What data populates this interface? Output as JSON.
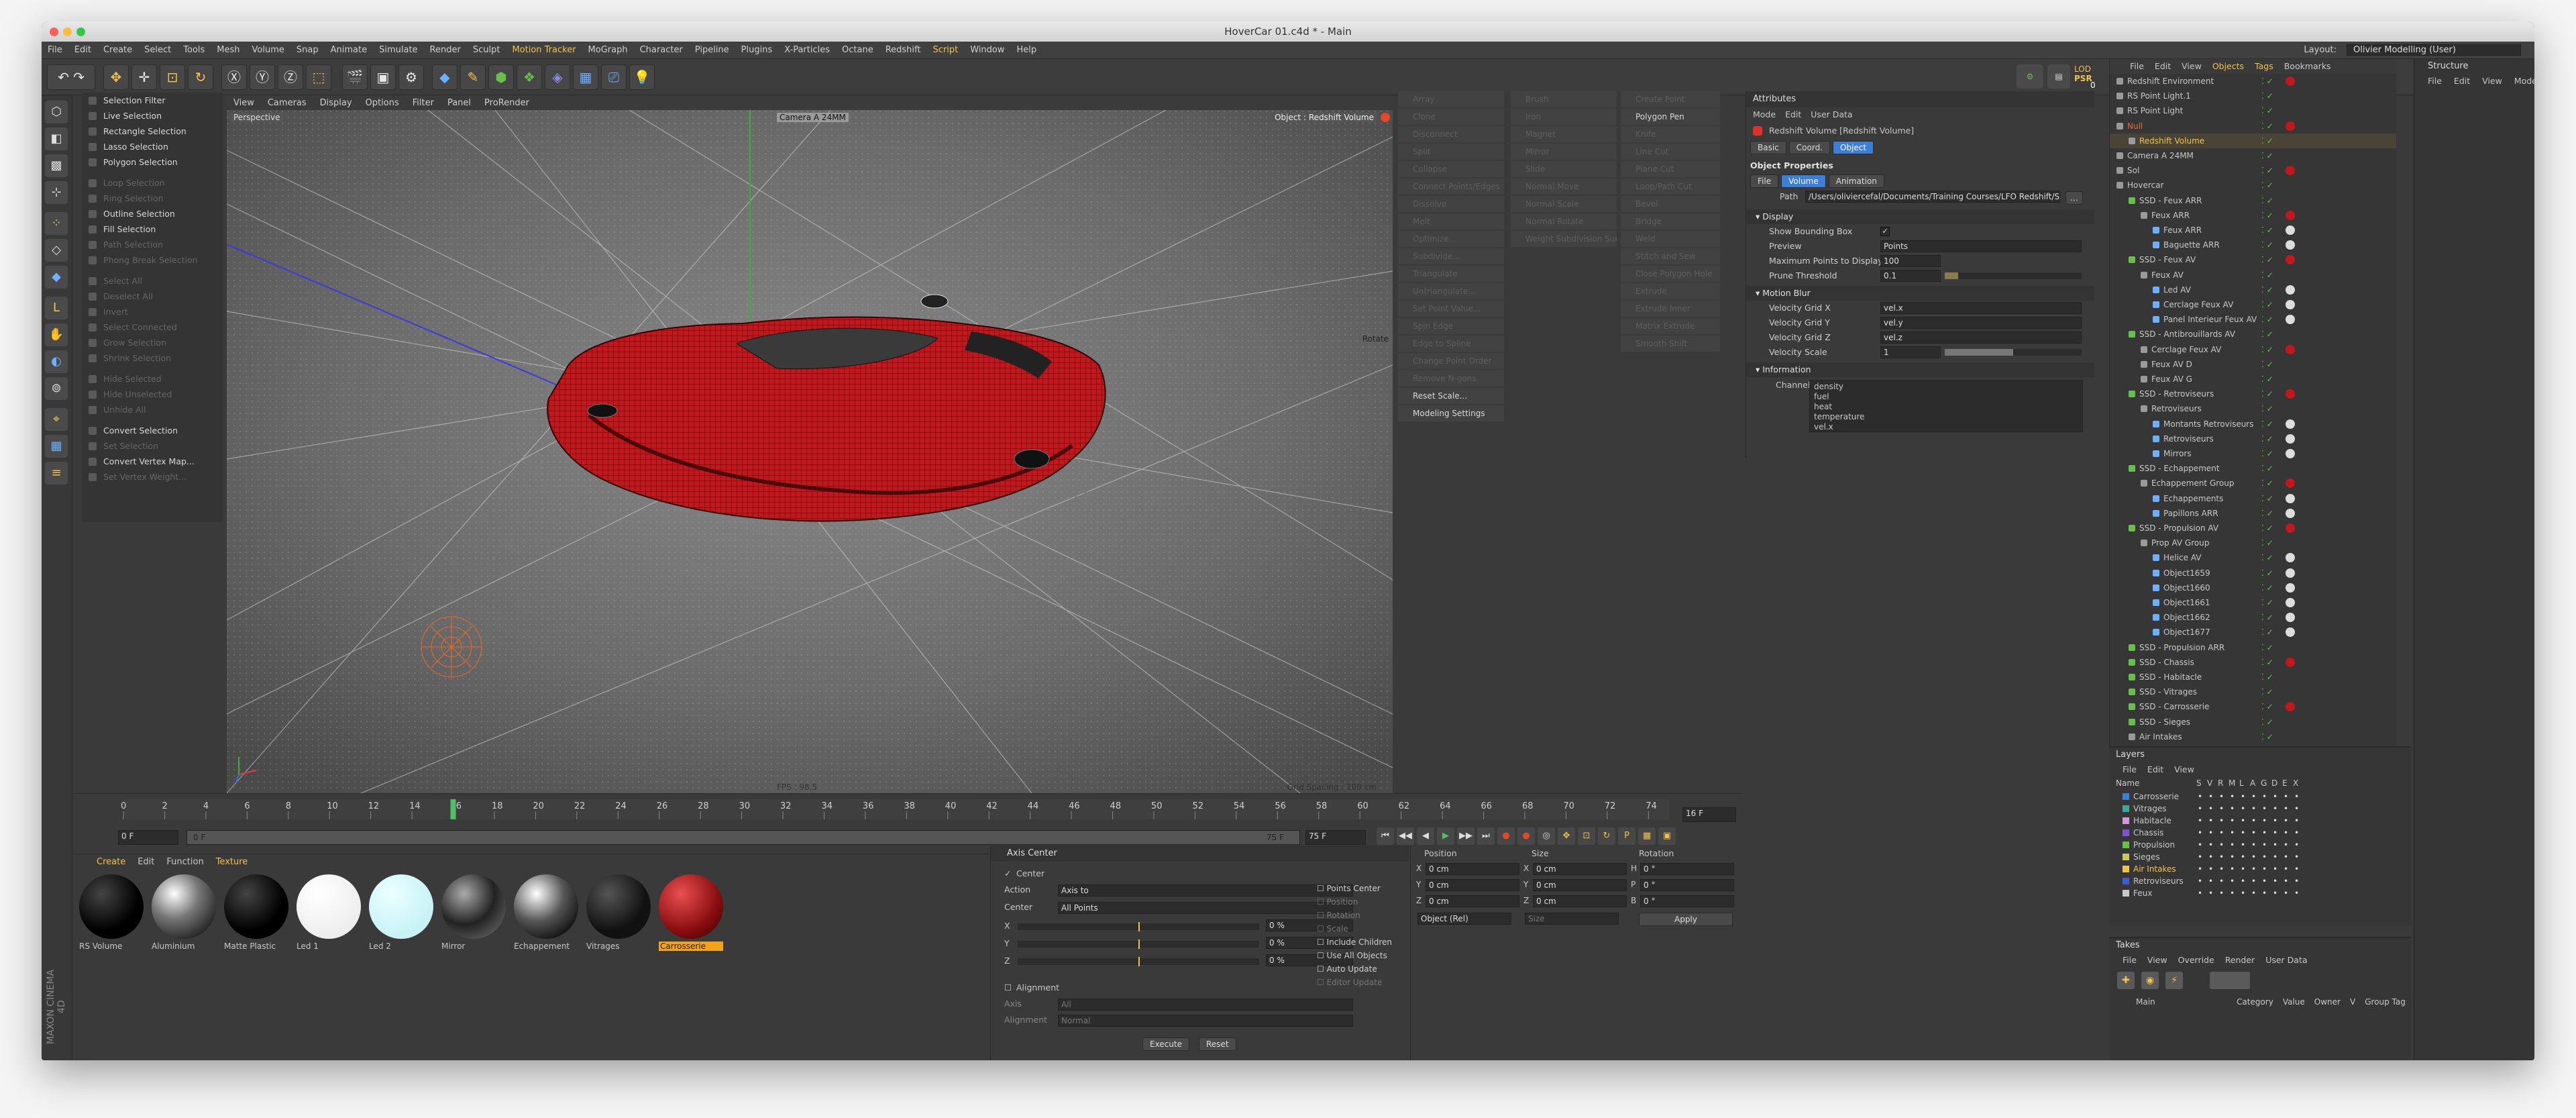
{
  "window": {
    "title": "HoverCar 01.c4d * - Main"
  },
  "menu": [
    "File",
    "Edit",
    "Create",
    "Select",
    "Tools",
    "Mesh",
    "Volume",
    "Snap",
    "Animate",
    "Simulate",
    "Render",
    "Sculpt",
    "Motion Tracker",
    "MoGraph",
    "Character",
    "Pipeline",
    "Plugins",
    "X-Particles",
    "Octane",
    "Redshift",
    "Script",
    "Window",
    "Help"
  ],
  "menu_highlight": [
    "Motion Tracker",
    "Script"
  ],
  "layout": {
    "label": "Layout:",
    "value": "Olivier Modelling (User)"
  },
  "toolbar": {
    "lod_label": "LOD",
    "psr_label": "PSR",
    "psr_value": "0"
  },
  "commands": [
    {
      "label": "Selection Filter",
      "on": true
    },
    {
      "label": "Live Selection",
      "on": true
    },
    {
      "label": "Rectangle Selection",
      "on": true
    },
    {
      "label": "Lasso Selection",
      "on": true
    },
    {
      "label": "Polygon Selection",
      "on": true
    },
    {
      "label": "Loop Selection",
      "on": false
    },
    {
      "label": "Ring Selection",
      "on": false
    },
    {
      "label": "Outline Selection",
      "on": true
    },
    {
      "label": "Fill Selection",
      "on": true
    },
    {
      "label": "Path Selection",
      "on": false
    },
    {
      "label": "Phong Break Selection",
      "on": false
    },
    {
      "label": "Select All",
      "on": false
    },
    {
      "label": "Deselect All",
      "on": false
    },
    {
      "label": "Invert",
      "on": false
    },
    {
      "label": "Select Connected",
      "on": false
    },
    {
      "label": "Grow Selection",
      "on": false
    },
    {
      "label": "Shrink Selection",
      "on": false
    },
    {
      "label": "Hide Selected",
      "on": false
    },
    {
      "label": "Hide Unselected",
      "on": false
    },
    {
      "label": "Unhide All",
      "on": false
    },
    {
      "label": "Convert Selection",
      "on": true
    },
    {
      "label": "Set Selection",
      "on": false
    },
    {
      "label": "Convert Vertex Map...",
      "on": true
    },
    {
      "label": "Set Vertex Weight...",
      "on": false
    }
  ],
  "viewport": {
    "menu": [
      "View",
      "Cameras",
      "Display",
      "Options",
      "Filter",
      "Panel",
      "ProRender"
    ],
    "mode": "Perspective",
    "camera": "Camera A 24MM",
    "object_label": "Object : Redshift Volume",
    "fps": "FPS : 98.5",
    "grid_spacing": "Grid Spacing : 100 cm",
    "rotate_label": "Rotate"
  },
  "right_commands": {
    "col1": [
      {
        "label": "Array",
        "on": false
      },
      {
        "label": "Clone",
        "on": false
      },
      {
        "label": "Disconnect",
        "on": false
      },
      {
        "label": "Split",
        "on": false
      },
      {
        "label": "Collapse",
        "on": false
      },
      {
        "label": "Connect Points/Edges",
        "on": false
      },
      {
        "label": "Dissolve",
        "on": false
      },
      {
        "label": "Melt",
        "on": false
      },
      {
        "label": "Optimize...",
        "on": false
      },
      {
        "label": "Subdivide...",
        "on": false
      },
      {
        "label": "Triangulate",
        "on": false
      },
      {
        "label": "Untriangulate...",
        "on": false
      },
      {
        "label": "Set Point Value...",
        "on": false
      },
      {
        "label": "Spin Edge",
        "on": false
      },
      {
        "label": "Edge to Spline",
        "on": false
      },
      {
        "label": "Change Point Order",
        "on": false
      },
      {
        "label": "Remove N-gons",
        "on": false
      },
      {
        "label": "Reset Scale...",
        "on": true
      },
      {
        "label": "Modeling Settings",
        "on": true
      }
    ],
    "col2": [
      {
        "label": "Brush",
        "on": false
      },
      {
        "label": "Iron",
        "on": false
      },
      {
        "label": "Magnet",
        "on": false
      },
      {
        "label": "Mirror",
        "on": false
      },
      {
        "label": "Slide",
        "on": false
      },
      {
        "label": "Normal Move",
        "on": false
      },
      {
        "label": "Normal Scale",
        "on": false
      },
      {
        "label": "Normal Rotate",
        "on": false
      },
      {
        "label": "Weight Subdivision Surface",
        "on": false
      }
    ],
    "col3": [
      {
        "label": "Create Point",
        "on": false
      },
      {
        "label": "Polygon Pen",
        "on": true
      },
      {
        "label": "Knife",
        "on": false
      },
      {
        "label": "Line Cut",
        "on": false
      },
      {
        "label": "Plane Cut",
        "on": false
      },
      {
        "label": "Loop/Path Cut",
        "on": false
      },
      {
        "label": "Bevel",
        "on": false
      },
      {
        "label": "Bridge",
        "on": false
      },
      {
        "label": "Weld",
        "on": false
      },
      {
        "label": "Stitch and Sew",
        "on": false
      },
      {
        "label": "Close Polygon Hole",
        "on": false
      },
      {
        "label": "Extrude",
        "on": false
      },
      {
        "label": "Extrude Inner",
        "on": false
      },
      {
        "label": "Matrix Extrude",
        "on": false
      },
      {
        "label": "Smooth Shift",
        "on": false
      }
    ]
  },
  "attributes": {
    "header": "Attributes",
    "menu": [
      "Mode",
      "Edit",
      "User Data"
    ],
    "object_title": "Redshift Volume [Redshift Volume]",
    "tabs": [
      "Basic",
      "Coord.",
      "Object"
    ],
    "section": "Object Properties",
    "subtabs": [
      "File",
      "Volume",
      "Animation"
    ],
    "path_label": "Path",
    "path_value": "/Users/oliviercefal/Documents/Training Courses/LFO Redshift/Sce",
    "display_section": "Display",
    "show_bbox": "Show Bounding Box",
    "preview_label": "Preview",
    "preview_value": "Points",
    "max_points_label": "Maximum Points to Display",
    "max_points_value": "100",
    "prune_label": "Prune Threshold",
    "prune_value": "0.1",
    "motion_section": "Motion Blur",
    "vgx_label": "Velocity Grid X",
    "vgx_value": "vel.x",
    "vgy_label": "Velocity Grid Y",
    "vgy_value": "vel.y",
    "vgz_label": "Velocity Grid Z",
    "vgz_value": "vel.z",
    "vscale_label": "Velocity Scale",
    "vscale_value": "1",
    "info_section": "Information",
    "channels_label": "Channels",
    "channels": [
      "density",
      "fuel",
      "heat",
      "temperature",
      "vel.x"
    ]
  },
  "object_manager": {
    "menu": [
      "File",
      "Edit",
      "View",
      "Objects",
      "Tags",
      "Bookmarks"
    ],
    "rows": [
      {
        "name": "Redshift Environment",
        "indent": 0,
        "color": "#c8c8c8"
      },
      {
        "name": "RS Point Light.1",
        "indent": 0,
        "color": "#c8c8c8"
      },
      {
        "name": "RS Point Light",
        "indent": 0,
        "color": "#c8c8c8"
      },
      {
        "name": "Null",
        "indent": 0,
        "color": "#e06a3a"
      },
      {
        "name": "Redshift Volume",
        "indent": 1,
        "color": "#f3c24d"
      },
      {
        "name": "Camera A 24MM",
        "indent": 0,
        "color": "#c8c8c8"
      },
      {
        "name": "Sol",
        "indent": 0,
        "color": "#c8c8c8"
      },
      {
        "name": "Hovercar",
        "indent": 0,
        "color": "#c8c8c8"
      },
      {
        "name": "SSD - Feux ARR",
        "indent": 1,
        "color": "#c8c8c8"
      },
      {
        "name": "Feux ARR",
        "indent": 2,
        "color": "#c8c8c8"
      },
      {
        "name": "Feux ARR",
        "indent": 3,
        "color": "#c8c8c8"
      },
      {
        "name": "Baguette ARR",
        "indent": 3,
        "color": "#c8c8c8"
      },
      {
        "name": "SSD - Feux AV",
        "indent": 1,
        "color": "#c8c8c8"
      },
      {
        "name": "Feux AV",
        "indent": 2,
        "color": "#c8c8c8"
      },
      {
        "name": "Led AV",
        "indent": 3,
        "color": "#c8c8c8"
      },
      {
        "name": "Cerclage Feux AV",
        "indent": 3,
        "color": "#c8c8c8"
      },
      {
        "name": "Panel Interieur Feux AV",
        "indent": 3,
        "color": "#c8c8c8"
      },
      {
        "name": "SSD - Antibrouillards AV",
        "indent": 1,
        "color": "#c8c8c8"
      },
      {
        "name": "Cerclage Feux AV",
        "indent": 2,
        "color": "#c8c8c8"
      },
      {
        "name": "Feux AV D",
        "indent": 2,
        "color": "#c8c8c8"
      },
      {
        "name": "Feux AV G",
        "indent": 2,
        "color": "#c8c8c8"
      },
      {
        "name": "SSD - Retroviseurs",
        "indent": 1,
        "color": "#c8c8c8"
      },
      {
        "name": "Retroviseurs",
        "indent": 2,
        "color": "#c8c8c8"
      },
      {
        "name": "Montants Retroviseurs",
        "indent": 3,
        "color": "#c8c8c8"
      },
      {
        "name": "Retroviseurs",
        "indent": 3,
        "color": "#c8c8c8"
      },
      {
        "name": "Mirrors",
        "indent": 3,
        "color": "#c8c8c8"
      },
      {
        "name": "SSD - Echappement",
        "indent": 1,
        "color": "#c8c8c8"
      },
      {
        "name": "Echappement Group",
        "indent": 2,
        "color": "#c8c8c8"
      },
      {
        "name": "Echappements",
        "indent": 3,
        "color": "#c8c8c8"
      },
      {
        "name": "Papillons ARR",
        "indent": 3,
        "color": "#c8c8c8"
      },
      {
        "name": "SSD - Propulsion AV",
        "indent": 1,
        "color": "#c8c8c8"
      },
      {
        "name": "Prop AV Group",
        "indent": 2,
        "color": "#c8c8c8"
      },
      {
        "name": "Helice AV",
        "indent": 3,
        "color": "#c8c8c8"
      },
      {
        "name": "Object1659",
        "indent": 3,
        "color": "#c8c8c8"
      },
      {
        "name": "Object1660",
        "indent": 3,
        "color": "#c8c8c8"
      },
      {
        "name": "Object1661",
        "indent": 3,
        "color": "#c8c8c8"
      },
      {
        "name": "Object1662",
        "indent": 3,
        "color": "#c8c8c8"
      },
      {
        "name": "Object1677",
        "indent": 3,
        "color": "#c8c8c8"
      },
      {
        "name": "SSD - Propulsion ARR",
        "indent": 1,
        "color": "#c8c8c8"
      },
      {
        "name": "SSD - Chassis",
        "indent": 1,
        "color": "#c8c8c8"
      },
      {
        "name": "SSD - Habitacle",
        "indent": 1,
        "color": "#c8c8c8"
      },
      {
        "name": "SSD - Vitrages",
        "indent": 1,
        "color": "#c8c8c8"
      },
      {
        "name": "SSD - Carrosserie",
        "indent": 1,
        "color": "#c8c8c8"
      },
      {
        "name": "SSD - Sieges",
        "indent": 1,
        "color": "#c8c8c8"
      },
      {
        "name": "Air Intakes",
        "indent": 1,
        "color": "#c8c8c8"
      }
    ]
  },
  "structure": {
    "header": "Structure",
    "menu": [
      "File",
      "Edit",
      "View",
      "Mode"
    ]
  },
  "layers": {
    "header": "Layers",
    "menu": [
      "File",
      "Edit",
      "View"
    ],
    "col_name": "Name",
    "cols": [
      "S",
      "V",
      "R",
      "M",
      "L",
      "A",
      "G",
      "D",
      "E",
      "X"
    ],
    "items": [
      {
        "name": "Carrosserie",
        "color": "#3d7fd6"
      },
      {
        "name": "Vitrages",
        "color": "#3aa89a"
      },
      {
        "name": "Habitacle",
        "color": "#d29ad6"
      },
      {
        "name": "Chassis",
        "color": "#7a55d0"
      },
      {
        "name": "Propulsion",
        "color": "#66c04a"
      },
      {
        "name": "Sieges",
        "color": "#c8c860"
      },
      {
        "name": "Air Intakes",
        "color": "#f3c24d"
      },
      {
        "name": "Retroviseurs",
        "color": "#3a5dd0"
      },
      {
        "name": "Feux",
        "color": "#c8c8c8"
      }
    ]
  },
  "takes": {
    "header": "Takes",
    "menu": [
      "File",
      "View",
      "Override",
      "Render",
      "User Data"
    ],
    "main_label": "Main",
    "cols": [
      "Category",
      "Value",
      "Owner",
      "V",
      "Group Tag"
    ]
  },
  "timeline": {
    "ticks": [
      "0",
      "2",
      "4",
      "6",
      "8",
      "10",
      "12",
      "14",
      "16",
      "18",
      "20",
      "22",
      "24",
      "26",
      "28",
      "30",
      "32",
      "34",
      "36",
      "38",
      "40",
      "42",
      "44",
      "46",
      "48",
      "50",
      "52",
      "54",
      "56",
      "58",
      "60",
      "62",
      "64",
      "66",
      "68",
      "70",
      "72",
      "74"
    ],
    "current_frame": "16 F",
    "playhead_frame": 16,
    "max_frame": 75,
    "start_field": "0 F",
    "range_start": "0 F",
    "range_end": "75 F",
    "end_field": "75 F",
    "range_label": "75 F"
  },
  "materials": {
    "menu": [
      "Create",
      "Edit",
      "Function",
      "Texture"
    ],
    "items": [
      {
        "name": "RS Volume",
        "kind": "dark"
      },
      {
        "name": "Aluminium",
        "kind": "metal"
      },
      {
        "name": "Matte Plastic",
        "kind": "dark"
      },
      {
        "name": "Led 1",
        "kind": "white"
      },
      {
        "name": "Led 2",
        "kind": "cyan"
      },
      {
        "name": "Mirror",
        "kind": "mirror"
      },
      {
        "name": "Echappement",
        "kind": "chrome"
      },
      {
        "name": "Vitrages",
        "kind": "glass"
      },
      {
        "name": "Carrosserie",
        "kind": "red"
      }
    ],
    "selected": "Carrosserie",
    "vendor": "MAXON CINEMA 4D"
  },
  "axis_center": {
    "title": "Axis Center",
    "center_label": "Center",
    "action_label": "Action",
    "action_value": "Axis to",
    "center_mode_label": "Center",
    "center_mode_value": "All Points",
    "x_label": "X",
    "x_value": "0 %",
    "y_label": "Y",
    "y_value": "0 %",
    "z_label": "Z",
    "z_value": "0 %",
    "alignment_cb": "Alignment",
    "axis_label": "Axis",
    "axis_value": "All",
    "alignment_label": "Alignment",
    "alignment_value": "Normal",
    "right_options": [
      "Points Center",
      "Position",
      "Rotation",
      "Scale",
      "Include Children",
      "Use All Objects",
      "Auto Update",
      "Editor Update"
    ],
    "execute": "Execute",
    "reset": "Reset"
  },
  "coords": {
    "headers": [
      "Position",
      "Size",
      "Rotation"
    ],
    "rows": [
      {
        "p": "X",
        "pv": "0 cm",
        "s": "X",
        "sv": "0 cm",
        "r": "H",
        "rv": "0 °"
      },
      {
        "p": "Y",
        "pv": "0 cm",
        "s": "Y",
        "sv": "0 cm",
        "r": "P",
        "rv": "0 °"
      },
      {
        "p": "Z",
        "pv": "0 cm",
        "s": "Z",
        "sv": "0 cm",
        "r": "B",
        "rv": "0 °"
      }
    ],
    "mode": "Object (Rel)",
    "size_mode": "Size",
    "apply": "Apply"
  },
  "colors": {
    "accent": "#f3c24d",
    "red": "#c0181c",
    "selected_tab": "#3d7fd6"
  }
}
